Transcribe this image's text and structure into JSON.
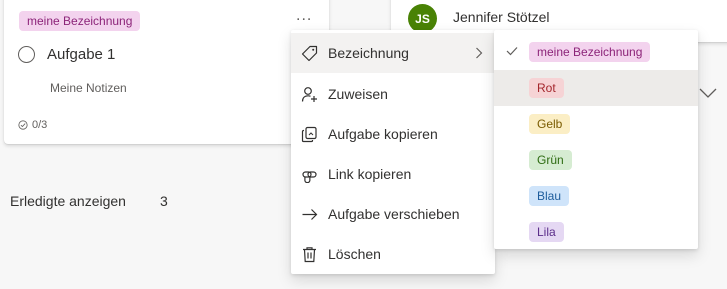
{
  "task": {
    "label": "meine Bezeichnung",
    "more": "...",
    "title": "Aufgabe 1",
    "notes": "Meine Notizen",
    "checklist": "0/3"
  },
  "assignee": {
    "initials": "JS",
    "name": "Jennifer Stötzel"
  },
  "completed": {
    "label": "Erledigte anzeigen",
    "count": "3"
  },
  "context_menu": {
    "items": [
      {
        "label": "Bezeichnung",
        "icon": "tag-icon",
        "has_submenu": true
      },
      {
        "label": "Zuweisen",
        "icon": "person-add-icon"
      },
      {
        "label": "Aufgabe kopieren",
        "icon": "copy-icon"
      },
      {
        "label": "Link kopieren",
        "icon": "link-icon"
      },
      {
        "label": "Aufgabe verschieben",
        "icon": "arrow-right-icon"
      },
      {
        "label": "Löschen",
        "icon": "trash-icon"
      }
    ]
  },
  "label_submenu": {
    "items": [
      {
        "label": "meine Bezeichnung",
        "bg": "#f3d3ee",
        "fg": "#8c2479",
        "selected": true
      },
      {
        "label": "Rot",
        "bg": "#f6d3d5",
        "fg": "#a4262c"
      },
      {
        "label": "Gelb",
        "bg": "#fbeec5",
        "fg": "#7a5b00"
      },
      {
        "label": "Grün",
        "bg": "#d6ecd2",
        "fg": "#2e6b12"
      },
      {
        "label": "Blau",
        "bg": "#cfe4fa",
        "fg": "#1d5c9c"
      },
      {
        "label": "Lila",
        "bg": "#e5d8f3",
        "fg": "#5b2d8a"
      }
    ]
  },
  "colors": {
    "avatar": "#498205",
    "menu_active": "#f3f2f1",
    "submenu_hover": "#edebe9"
  }
}
